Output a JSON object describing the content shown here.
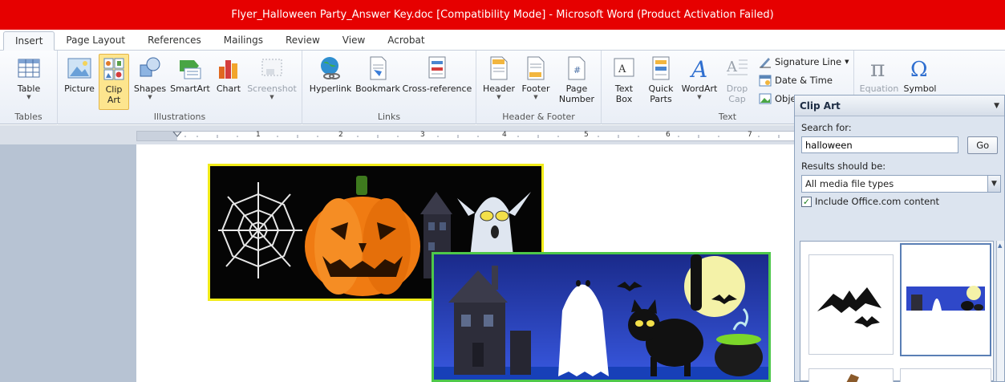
{
  "window": {
    "title": "Flyer_Halloween Party_Answer Key.doc [Compatibility Mode]  -  Microsoft Word (Product Activation Failed)"
  },
  "tabs": [
    "Insert",
    "Page Layout",
    "References",
    "Mailings",
    "Review",
    "View",
    "Acrobat"
  ],
  "active_tab": "Insert",
  "ribbon": {
    "tables": {
      "label": "Tables",
      "table": "Table"
    },
    "illustrations": {
      "label": "Illustrations",
      "picture": "Picture",
      "clip_art_line1": "Clip",
      "clip_art_line2": "Art",
      "shapes": "Shapes",
      "smartart": "SmartArt",
      "chart": "Chart",
      "screenshot": "Screenshot"
    },
    "links": {
      "label": "Links",
      "hyperlink": "Hyperlink",
      "bookmark": "Bookmark",
      "cross_reference": "Cross-reference"
    },
    "header_footer": {
      "label": "Header & Footer",
      "header": "Header",
      "footer": "Footer",
      "page_number_line1": "Page",
      "page_number_line2": "Number"
    },
    "text": {
      "label": "Text",
      "text_box_line1": "Text",
      "text_box_line2": "Box",
      "quick_parts_line1": "Quick",
      "quick_parts_line2": "Parts",
      "wordart": "WordArt",
      "drop_cap_line1": "Drop",
      "drop_cap_line2": "Cap",
      "signature_line": "Signature Line",
      "date_time": "Date & Time",
      "object": "Obje"
    },
    "symbols": {
      "equation": "Equation",
      "symbol": "Symbol"
    }
  },
  "ruler": {
    "numbers": [
      "1",
      "2",
      "3",
      "4",
      "5",
      "6",
      "7"
    ]
  },
  "clip_art_pane": {
    "title": "Clip Art",
    "search_label": "Search for:",
    "search_value": "halloween",
    "go_label": "Go",
    "results_label": "Results should be:",
    "results_value": "All media file types",
    "include_office": "Include Office.com content",
    "include_office_checked": true
  },
  "colors": {
    "titlebar": "#e60000",
    "pic1_border": "#f2ec1a",
    "pic2_border": "#4ec84a",
    "selected_button": "#fde58e"
  }
}
